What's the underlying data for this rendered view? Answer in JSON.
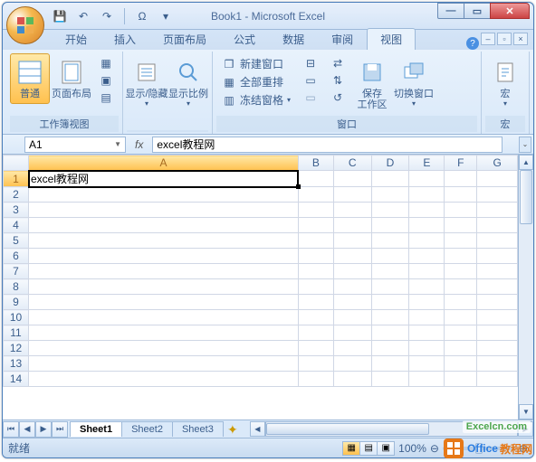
{
  "title": "Book1 - Microsoft Excel",
  "qat": {
    "save": "💾",
    "undo": "↶",
    "redo": "↷",
    "sym": "Ω"
  },
  "tabs": [
    "开始",
    "插入",
    "页面布局",
    "公式",
    "数据",
    "审阅",
    "视图"
  ],
  "active_tab": 6,
  "ribbon": {
    "g1": {
      "label": "工作簿视图",
      "normal": "普通",
      "layout": "页面布局"
    },
    "g2": {
      "label": "",
      "show_hide": "显示/隐藏",
      "zoom": "显示比例"
    },
    "g3": {
      "label": "窗口",
      "new_win": "新建窗口",
      "arrange": "全部重排",
      "freeze": "冻结窗格",
      "save_ws": "保存\n工作区",
      "switch": "切换窗口"
    },
    "g4": {
      "label": "宏",
      "macro": "宏"
    }
  },
  "namebox": "A1",
  "fx": "fx",
  "formula": "excel教程网",
  "cols": [
    "A",
    "B",
    "C",
    "D",
    "E",
    "F",
    "G"
  ],
  "rows": [
    "1",
    "2",
    "3",
    "4",
    "5",
    "6",
    "7",
    "8",
    "9",
    "10",
    "11",
    "12",
    "13",
    "14"
  ],
  "cell_a1": "excel教程网",
  "sheets": [
    "Sheet1",
    "Sheet2",
    "Sheet3"
  ],
  "status": "就绪",
  "zoom": "100%",
  "watermark": {
    "p1": "Office",
    "p2": "教程网",
    "sub": "Excelcn.com"
  }
}
